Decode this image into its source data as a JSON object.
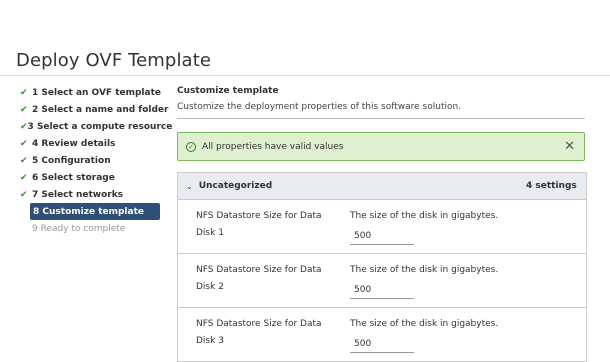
{
  "window_title": "Deploy OVF Template",
  "steps": [
    {
      "label": "1 Select an OVF template",
      "state": "done"
    },
    {
      "label": "2 Select a name and folder",
      "state": "done"
    },
    {
      "label": "3 Select a compute resource",
      "state": "done"
    },
    {
      "label": "4 Review details",
      "state": "done"
    },
    {
      "label": "5 Configuration",
      "state": "done"
    },
    {
      "label": "6 Select storage",
      "state": "done"
    },
    {
      "label": "7 Select networks",
      "state": "done"
    },
    {
      "label": "8 Customize template",
      "state": "active"
    },
    {
      "label": "9 Ready to complete",
      "state": "pending"
    }
  ],
  "section": {
    "title": "Customize template",
    "subtitle": "Customize the deployment properties of this software solution."
  },
  "alert": {
    "message": "All properties have valid values",
    "color": "#dff0d0"
  },
  "group": {
    "name": "Uncategorized",
    "count": "4 settings"
  },
  "properties": [
    {
      "name_line1": "NFS Datastore Size for Data",
      "name_line2": "Disk 1",
      "description": "The size of the disk in gigabytes.",
      "value": "500"
    },
    {
      "name_line1": "NFS Datastore Size for Data",
      "name_line2": "Disk 2",
      "description": "The size of the disk in gigabytes.",
      "value": "500"
    },
    {
      "name_line1": "NFS Datastore Size for Data",
      "name_line2": "Disk 3",
      "description": "The size of the disk in gigabytes.",
      "value": "500"
    }
  ]
}
